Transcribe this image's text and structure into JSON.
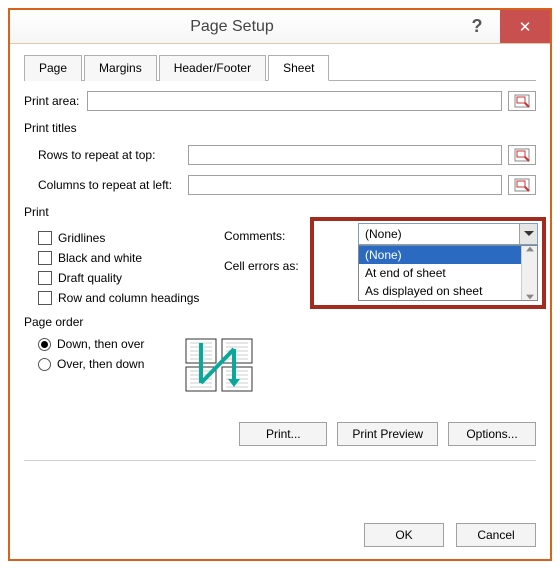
{
  "window": {
    "title": "Page Setup"
  },
  "tabs": {
    "page": "Page",
    "margins": "Margins",
    "headerfooter": "Header/Footer",
    "sheet": "Sheet"
  },
  "labels": {
    "print_area": "Print area:",
    "print_titles": "Print titles",
    "rows_repeat": "Rows to repeat at top:",
    "cols_repeat": "Columns to repeat at left:",
    "print": "Print",
    "gridlines": "Gridlines",
    "bw": "Black and white",
    "draft": "Draft quality",
    "rowcol": "Row and column headings",
    "comments": "Comments:",
    "cellerrors": "Cell errors as:",
    "page_order": "Page order",
    "down_over": "Down, then over",
    "over_down": "Over, then down"
  },
  "inputs": {
    "print_area": "",
    "rows_repeat": "",
    "cols_repeat": ""
  },
  "comments_select": {
    "value": "(None)",
    "options": [
      "(None)",
      "At end of sheet",
      "As displayed on sheet"
    ]
  },
  "buttons": {
    "print": "Print...",
    "preview": "Print Preview",
    "options": "Options...",
    "ok": "OK",
    "cancel": "Cancel"
  }
}
